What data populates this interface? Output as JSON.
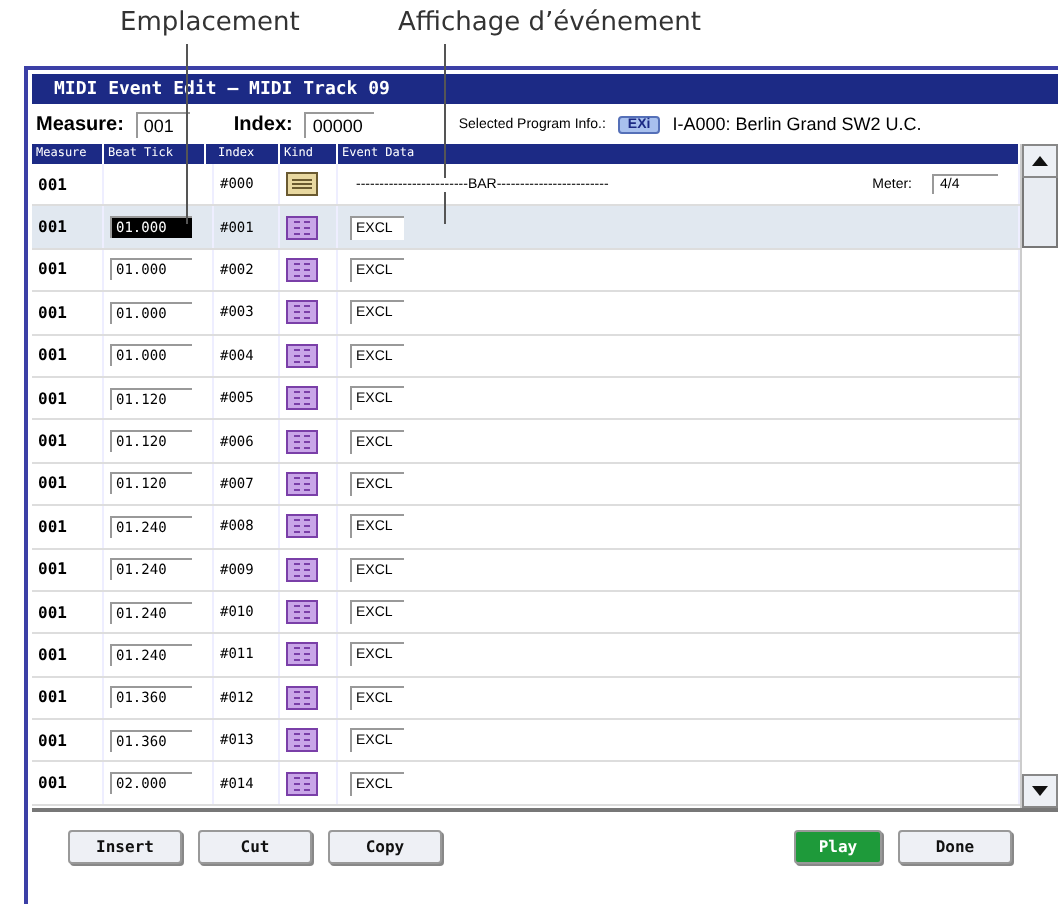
{
  "annotations": [
    {
      "text": "Emplacement"
    },
    {
      "text": "Affichage d’événement"
    }
  ],
  "window": {
    "title": "MIDI Event Edit – MIDI Track 09"
  },
  "measure": {
    "label": "Measure:",
    "value": "001"
  },
  "index": {
    "label": "Index:",
    "value": "00000"
  },
  "program_info": {
    "label": "Selected Program Info.:",
    "badge": "EXi",
    "name": "I-A000: Berlin Grand SW2 U.C."
  },
  "table": {
    "columns": [
      "Measure",
      "Beat Tick",
      "Index",
      "Kind",
      "Event Data"
    ],
    "rows": [
      {
        "kind": "bar",
        "measure": "001",
        "index": "#000",
        "event": "------------------------BAR------------------------",
        "meter_label": "Meter:",
        "meter": "4/4",
        "selected": false
      },
      {
        "kind": "excl",
        "measure": "001",
        "beat_tick": "01.000",
        "index": "#001",
        "event": "EXCL",
        "selected": true
      },
      {
        "kind": "excl",
        "measure": "001",
        "beat_tick": "01.000",
        "index": "#002",
        "event": "EXCL",
        "selected": false
      },
      {
        "kind": "excl",
        "measure": "001",
        "beat_tick": "01.000",
        "index": "#003",
        "event": "EXCL",
        "selected": false
      },
      {
        "kind": "excl",
        "measure": "001",
        "beat_tick": "01.000",
        "index": "#004",
        "event": "EXCL",
        "selected": false
      },
      {
        "kind": "excl",
        "measure": "001",
        "beat_tick": "01.120",
        "index": "#005",
        "event": "EXCL",
        "selected": false
      },
      {
        "kind": "excl",
        "measure": "001",
        "beat_tick": "01.120",
        "index": "#006",
        "event": "EXCL",
        "selected": false
      },
      {
        "kind": "excl",
        "measure": "001",
        "beat_tick": "01.120",
        "index": "#007",
        "event": "EXCL",
        "selected": false
      },
      {
        "kind": "excl",
        "measure": "001",
        "beat_tick": "01.240",
        "index": "#008",
        "event": "EXCL",
        "selected": false
      },
      {
        "kind": "excl",
        "measure": "001",
        "beat_tick": "01.240",
        "index": "#009",
        "event": "EXCL",
        "selected": false
      },
      {
        "kind": "excl",
        "measure": "001",
        "beat_tick": "01.240",
        "index": "#010",
        "event": "EXCL",
        "selected": false
      },
      {
        "kind": "excl",
        "measure": "001",
        "beat_tick": "01.240",
        "index": "#011",
        "event": "EXCL",
        "selected": false
      },
      {
        "kind": "excl",
        "measure": "001",
        "beat_tick": "01.360",
        "index": "#012",
        "event": "EXCL",
        "selected": false
      },
      {
        "kind": "excl",
        "measure": "001",
        "beat_tick": "01.360",
        "index": "#013",
        "event": "EXCL",
        "selected": false
      },
      {
        "kind": "excl",
        "measure": "001",
        "beat_tick": "02.000",
        "index": "#014",
        "event": "EXCL",
        "selected": false
      }
    ]
  },
  "buttons": [
    {
      "label": "Insert",
      "kind": "normal"
    },
    {
      "label": "Cut",
      "kind": "normal"
    },
    {
      "label": "Copy",
      "kind": "normal"
    },
    {
      "label": "Play",
      "kind": "play"
    },
    {
      "label": "Done",
      "kind": "normal"
    }
  ]
}
